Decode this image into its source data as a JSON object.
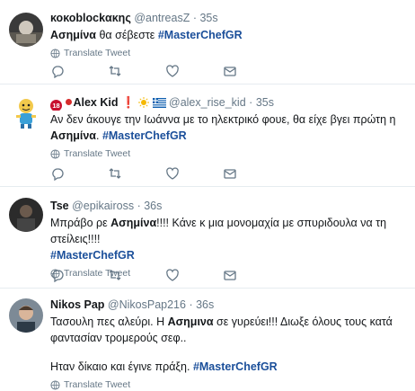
{
  "tweets": [
    {
      "name": "κοκοblockακης",
      "handle": "@antreasZ",
      "time": "35s",
      "text_bold": "Ασημίνα",
      "text_rest": " θα σέβεστε ",
      "hashtag": "#MasterChefGR",
      "translate": "Translate Tweet"
    },
    {
      "badge": "18",
      "name": "Alex Kid",
      "excl": "❗",
      "handle": "@alex_rise_kid",
      "time": "35s",
      "text_line1": "Αν δεν άκουγε την Ιωάννα με το ηλεκτρικό φουε, θα είχε βγει πρώτη η",
      "text_bold": "Ασημίνα",
      "text_after": ". ",
      "hashtag": "#MasterChefGR",
      "translate": "Translate Tweet"
    },
    {
      "name": "Tse",
      "handle": "@epikaiross",
      "time": "36s",
      "text_before": "Μπράβο ρε ",
      "text_bold": "Ασημίνα",
      "text_after": "!!!! Κάνε κ μια μονομαχία με σπυριδουλα να τη στείλεις!!!!",
      "hashtag": "#MasterChefGR",
      "translate": "Translate Tweet"
    },
    {
      "name": "Nikos Pap",
      "handle": "@NikosPap216",
      "time": "36s",
      "text_before": "Τασουλη πες αλεύρι. Η ",
      "text_bold": "Ασημινα",
      "text_after": " σε γυρεύει!!! Διωξε όλους τους κατά φαντασίαν τρομερούς σεφ..",
      "text_line2": "Ηταν δίκαιο και έγινε πράξη. ",
      "hashtag": "#MasterChefGR",
      "translate": "Translate Tweet"
    }
  ],
  "separator": "·",
  "colors": {
    "hashtag": "#1b4f9a",
    "muted": "#657786",
    "border": "#e6ecf0"
  },
  "actions": [
    "reply-icon",
    "retweet-icon",
    "like-icon",
    "message-icon"
  ]
}
